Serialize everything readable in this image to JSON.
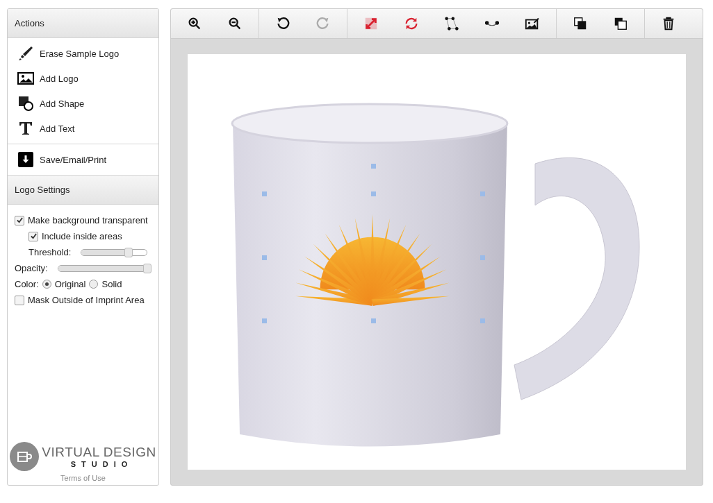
{
  "sidebar": {
    "actions_header": "Actions",
    "actions": [
      {
        "kind": "marker",
        "label": "Erase Sample Logo"
      },
      {
        "kind": "image",
        "label": "Add Logo"
      },
      {
        "kind": "shape",
        "label": "Add Shape"
      },
      {
        "kind": "text",
        "label": "Add Text"
      }
    ],
    "save_action": {
      "kind": "download",
      "label": "Save/Email/Print"
    },
    "settings_header": "Logo Settings",
    "settings": {
      "transparent": {
        "label": "Make background transparent",
        "checked": true
      },
      "inside": {
        "label": "Include inside areas",
        "checked": true
      },
      "threshold": {
        "label": "Threshold:",
        "level": 0.74
      },
      "opacity": {
        "label": "Opacity:",
        "level": 1
      },
      "color": {
        "label": "Color:",
        "options": [
          {
            "label": "Original",
            "selected": true
          },
          {
            "label": "Solid",
            "selected": false
          }
        ]
      },
      "mask": {
        "label": "Mask Outside of Imprint Area",
        "checked": false
      }
    },
    "logo": {
      "line1": "VIRTUAL DESIGN",
      "line2": "STUDIO"
    },
    "terms_link": "Terms of Use"
  },
  "toolbar": [
    [
      {
        "kind": "zoom-in",
        "disabled": false
      },
      {
        "kind": "zoom-out",
        "disabled": false
      }
    ],
    [
      {
        "kind": "rotate-left",
        "disabled": false
      },
      {
        "kind": "rotate-right",
        "disabled": true
      }
    ],
    [
      {
        "kind": "resize",
        "disabled": false
      },
      {
        "kind": "rotate-both",
        "disabled": false
      },
      {
        "kind": "nodes",
        "disabled": false
      },
      {
        "kind": "curve",
        "disabled": false
      },
      {
        "kind": "edit-image",
        "disabled": false
      }
    ],
    [
      {
        "kind": "bring-front",
        "disabled": false
      },
      {
        "kind": "send-back",
        "disabled": false
      }
    ],
    [
      {
        "kind": "trash",
        "disabled": false
      }
    ]
  ]
}
